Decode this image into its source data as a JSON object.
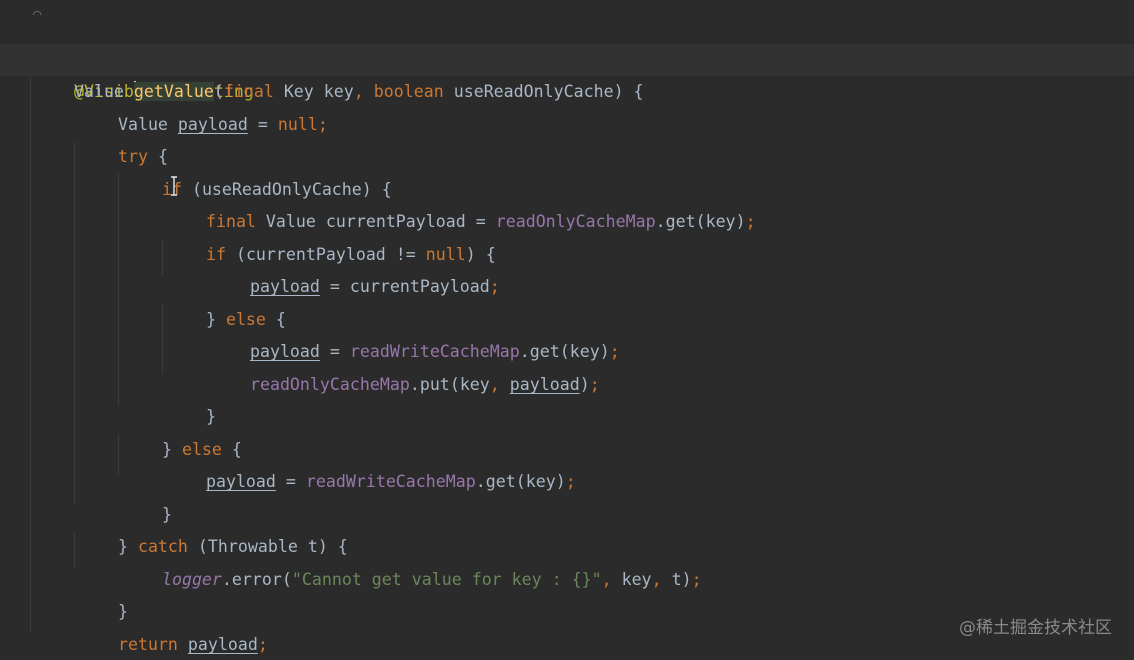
{
  "editor": {
    "language": "java",
    "colors": {
      "background": "#2b2b2b",
      "current_line": "#323232",
      "default_text": "#a9b7c6",
      "keyword": "#cc7832",
      "annotation": "#bbb529",
      "method_declaration": "#ffc66d",
      "field": "#9876aa",
      "string": "#6a8759"
    },
    "code": {
      "annotation": "@VisibleForTesting",
      "k_final": "final",
      "k_boolean": "boolean",
      "k_null": "null",
      "k_try": "try",
      "k_if": "if",
      "k_else": "else",
      "k_catch": "catch",
      "k_return": "return",
      "type_value": "Value",
      "type_key": "Key",
      "type_throwable": "Throwable",
      "method_name": "getValue",
      "param_key": "key",
      "param_cache": "useReadOnlyCache",
      "var_payload": "payload",
      "var_current": "currentPayload",
      "var_t": "t",
      "field_readonly": "readOnlyCacheMap",
      "field_readwrite": "readWriteCacheMap",
      "field_logger": "logger",
      "call_get": "get",
      "call_put": "put",
      "call_error": "error",
      "log_message": "\"Cannot get value for key : {}\""
    }
  },
  "watermark": {
    "text": "@稀土掘金技术社区"
  }
}
